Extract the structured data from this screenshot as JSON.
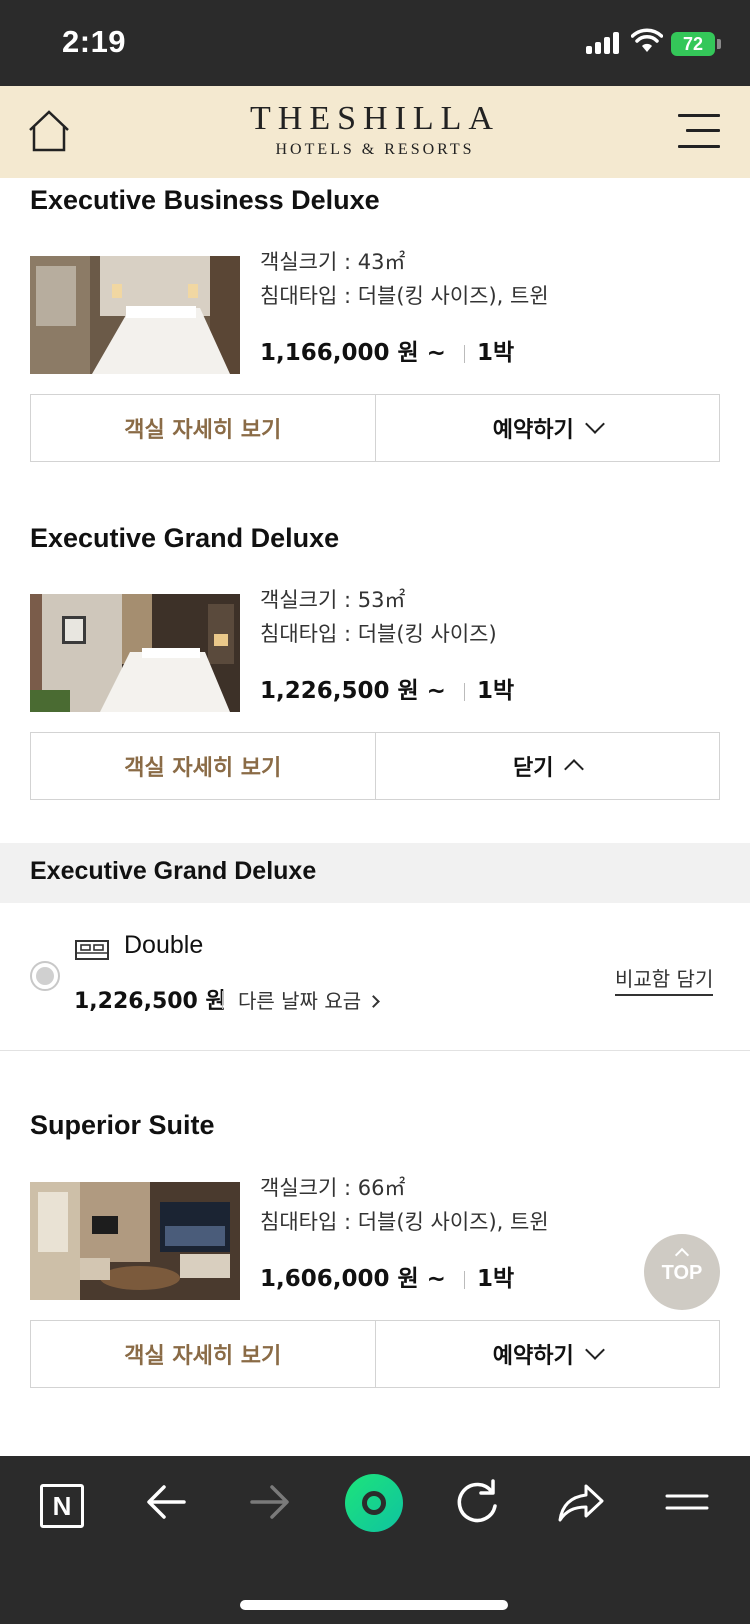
{
  "status_bar": {
    "time": "2:19",
    "battery": "72"
  },
  "header": {
    "logo_line1": "THESHILLA",
    "logo_line2": "HOTELS & RESORTS"
  },
  "rooms": [
    {
      "name": "Executive Business Deluxe",
      "size": "객실크기 : 43㎡",
      "bed": "침대타입 : 더블(킹 사이즈), 트윈",
      "price": "1,166,000 원 ~",
      "nights": "1박",
      "detail_label": "객실 자세히 보기",
      "action_label": "예약하기"
    },
    {
      "name": "Executive Grand Deluxe",
      "size": "객실크기 : 53㎡",
      "bed": "침대타입 : 더블(킹 사이즈)",
      "price": "1,226,500 원 ~",
      "nights": "1박",
      "detail_label": "객실 자세히 보기",
      "action_label": "닫기"
    },
    {
      "name": "Superior Suite",
      "size": "객실크기 : 66㎡",
      "bed": "침대타입 : 더블(킹 사이즈), 트윈",
      "price": "1,606,000 원 ~",
      "nights": "1박",
      "detail_label": "객실 자세히 보기",
      "action_label": "예약하기"
    }
  ],
  "expanded": {
    "title": "Executive Grand Deluxe",
    "bed_label": "Double",
    "price": "1,226,500 원",
    "other_dates": "다른 날짜 요금",
    "compare": "비교함 담기"
  },
  "top_button": "TOP",
  "bottom_bar": {
    "n_label": "N"
  },
  "colors": {
    "header_bg": "#f4e9d0",
    "detail_text": "#8a6b46",
    "bar_bg": "#2b2b2b",
    "green": "#1de47a"
  }
}
